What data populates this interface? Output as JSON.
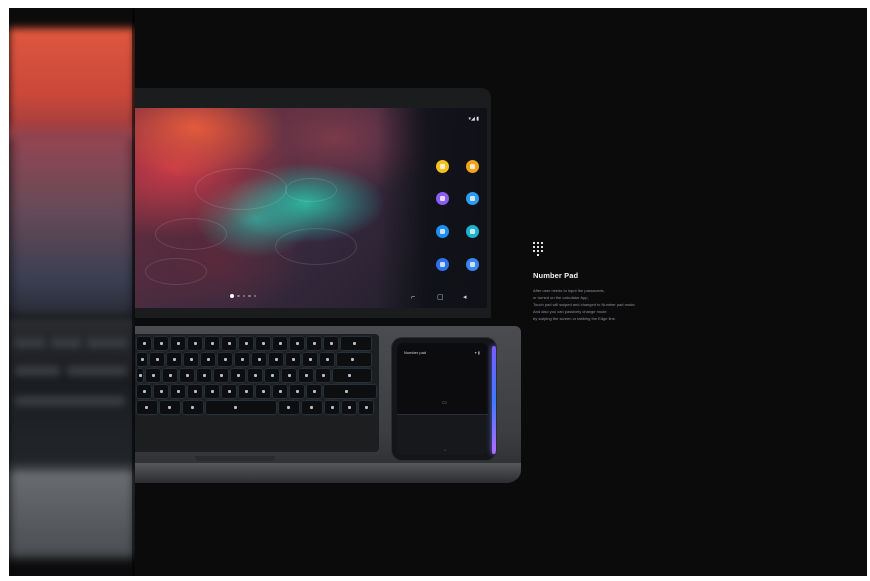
{
  "phone": {
    "title": "Number pad"
  },
  "feature": {
    "icon": "dial-grid-icon",
    "title": "Number Pad",
    "description_lines": [
      "After user needs to input the passwords,",
      "or turned on the calculator App,",
      "Touch pad will swiped and changed to Number pad mode.",
      "And also you can passively change mode",
      "by swiping the screen or tabbing the Edge line."
    ]
  },
  "colors": {
    "frame_bg": "#0b0b0c",
    "edge_glow": "#6a7bff"
  }
}
